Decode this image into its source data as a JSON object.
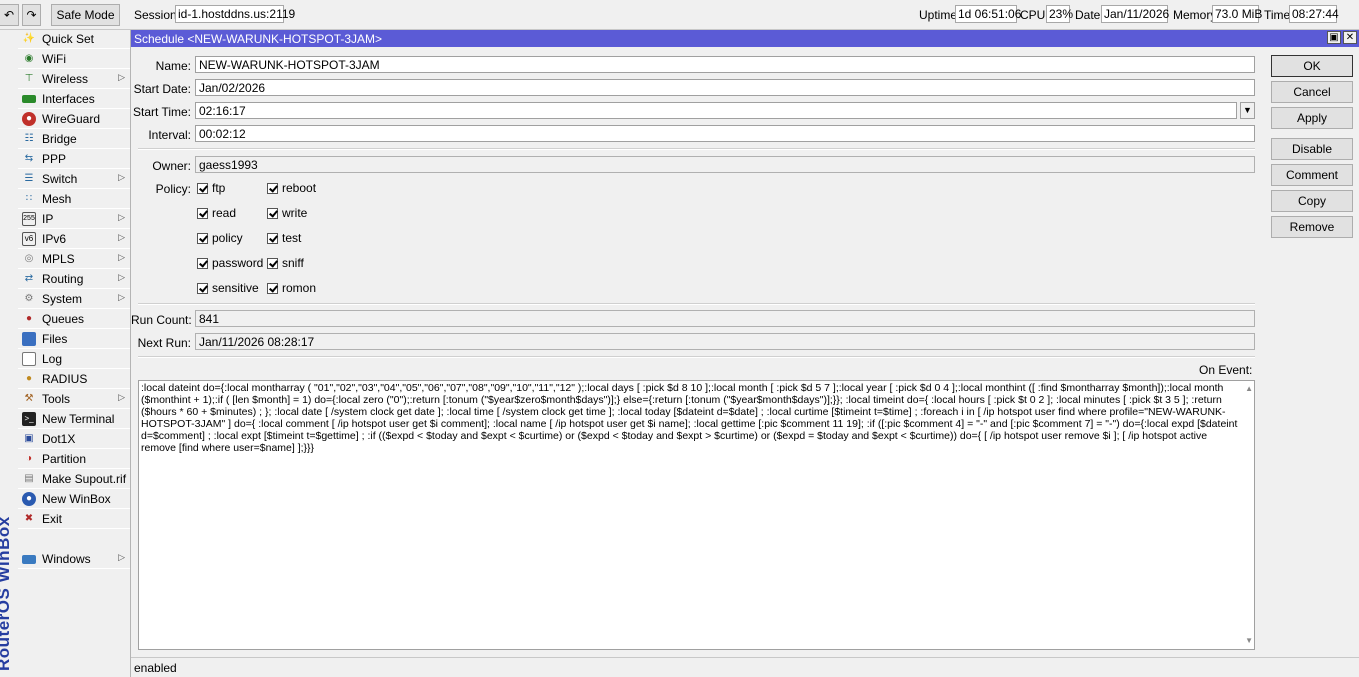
{
  "toolbar": {
    "safe_mode": "Safe Mode",
    "session_label": "Session:",
    "session_value": "id-1.hostddns.us:2119",
    "uptime_label": "Uptime:",
    "uptime_value": "1d 06:51:06",
    "cpu_label": "CPU:",
    "cpu_value": "23%",
    "date_label": "Date:",
    "date_value": "Jan/11/2026",
    "memory_label": "Memory:",
    "memory_value": "73.0 MiB",
    "time_label": "Time:",
    "time_value": "08:27:44"
  },
  "brand": "RouterOS WinBox",
  "sidebar": {
    "items": [
      {
        "label": "Quick Set",
        "icon": "wand-icon",
        "submenu": false
      },
      {
        "label": "WiFi",
        "icon": "wifi-icon",
        "submenu": false
      },
      {
        "label": "Wireless",
        "icon": "antenna-icon",
        "submenu": true
      },
      {
        "label": "Interfaces",
        "icon": "interfaces-icon",
        "submenu": false
      },
      {
        "label": "WireGuard",
        "icon": "wireguard-icon",
        "submenu": false
      },
      {
        "label": "Bridge",
        "icon": "bridge-icon",
        "submenu": false
      },
      {
        "label": "PPP",
        "icon": "ppp-icon",
        "submenu": false
      },
      {
        "label": "Switch",
        "icon": "switch-icon",
        "submenu": true
      },
      {
        "label": "Mesh",
        "icon": "mesh-icon",
        "submenu": false
      },
      {
        "label": "IP",
        "icon": "ip-icon",
        "submenu": true
      },
      {
        "label": "IPv6",
        "icon": "ipv6-icon",
        "submenu": true
      },
      {
        "label": "MPLS",
        "icon": "mpls-icon",
        "submenu": true
      },
      {
        "label": "Routing",
        "icon": "routing-icon",
        "submenu": true
      },
      {
        "label": "System",
        "icon": "system-gear-icon",
        "submenu": true
      },
      {
        "label": "Queues",
        "icon": "queues-icon",
        "submenu": false
      },
      {
        "label": "Files",
        "icon": "folder-icon",
        "submenu": false
      },
      {
        "label": "Log",
        "icon": "log-icon",
        "submenu": false
      },
      {
        "label": "RADIUS",
        "icon": "radius-users-icon",
        "submenu": false
      },
      {
        "label": "Tools",
        "icon": "tools-icon",
        "submenu": true
      },
      {
        "label": "New Terminal",
        "icon": "terminal-icon",
        "submenu": false
      },
      {
        "label": "Dot1X",
        "icon": "dot1x-icon",
        "submenu": false
      },
      {
        "label": "Partition",
        "icon": "partition-icon",
        "submenu": false
      },
      {
        "label": "Make Supout.rif",
        "icon": "supout-icon",
        "submenu": false
      },
      {
        "label": "New WinBox",
        "icon": "winbox-icon",
        "submenu": false
      },
      {
        "label": "Exit",
        "icon": "exit-icon",
        "submenu": false
      }
    ],
    "windows_label": "Windows"
  },
  "window": {
    "title": "Schedule <NEW-WARUNK-HOTSPOT-3JAM>",
    "fields": {
      "name_label": "Name:",
      "name_value": "NEW-WARUNK-HOTSPOT-3JAM",
      "start_date_label": "Start Date:",
      "start_date_value": "Jan/02/2026",
      "start_time_label": "Start Time:",
      "start_time_value": "02:16:17",
      "interval_label": "Interval:",
      "interval_value": "00:02:12",
      "owner_label": "Owner:",
      "owner_value": "gaess1993",
      "policy_label": "Policy:",
      "run_count_label": "Run Count:",
      "run_count_value": "841",
      "next_run_label": "Next Run:",
      "next_run_value": "Jan/11/2026 08:28:17",
      "on_event_label": "On Event:"
    },
    "policies": [
      {
        "label": "ftp",
        "checked": true
      },
      {
        "label": "reboot",
        "checked": true
      },
      {
        "label": "read",
        "checked": true
      },
      {
        "label": "write",
        "checked": true
      },
      {
        "label": "policy",
        "checked": true
      },
      {
        "label": "test",
        "checked": true
      },
      {
        "label": "password",
        "checked": true
      },
      {
        "label": "sniff",
        "checked": true
      },
      {
        "label": "sensitive",
        "checked": true
      },
      {
        "label": "romon",
        "checked": true
      }
    ],
    "buttons": {
      "ok": "OK",
      "cancel": "Cancel",
      "apply": "Apply",
      "disable": "Disable",
      "comment": "Comment",
      "copy": "Copy",
      "remove": "Remove"
    },
    "script": ":local dateint do={:local montharray ( \"01\",\"02\",\"03\",\"04\",\"05\",\"06\",\"07\",\"08\",\"09\",\"10\",\"11\",\"12\" );:local days [ :pick $d 8 10 ];:local month [ :pick $d 5 7 ];:local year [ :pick $d 0 4 ];:local monthint ([ :find $montharray $month]);:local month ($monthint + 1);:if ( [len $month] = 1) do={:local zero (\"0\");:return [:tonum (\"$year$zero$month$days\")];} else={:return [:tonum (\"$year$month$days\")];}}; :local timeint do={ :local hours [ :pick $t 0 2 ]; :local minutes [ :pick $t 3 5 ]; :return ($hours * 60 + $minutes) ; }; :local date [ /system clock get date ]; :local time [ /system clock get time ]; :local today [$dateint d=$date] ; :local curtime [$timeint t=$time] ; :foreach i in [ /ip hotspot user find where profile=\"NEW-WARUNK-HOTSPOT-3JAM\" ] do={ :local comment [ /ip hotspot user get $i comment]; :local name [ /ip hotspot user get $i name]; :local gettime [:pic $comment 11 19]; :if ([:pic $comment 4] = \"-\" and [:pic $comment 7] = \"-\") do={:local expd [$dateint d=$comment] ; :local expt [$timeint t=$gettime] ; :if (($expd < $today and $expt < $curtime) or ($expd < $today and $expt > $curtime) or ($expd = $today and $expt < $curtime)) do={ [ /ip hotspot user remove $i ]; [ /ip hotspot active remove [find where user=$name] ];}}}"
  },
  "status": "enabled",
  "colors": {
    "title_bar": "#5b5bd6",
    "brand_text": "#253da0"
  }
}
